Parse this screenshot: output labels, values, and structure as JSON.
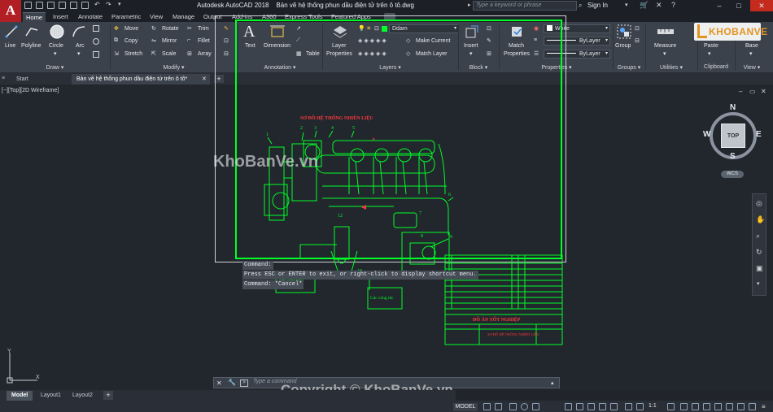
{
  "window": {
    "app_name": "Autodesk AutoCAD 2018",
    "file_name": "Bản vẽ hệ thống phun dầu điện tử trên ô tô.dwg"
  },
  "search": {
    "placeholder": "Type a keyword or phrase"
  },
  "user": {
    "signin": "Sign In"
  },
  "ribbon_tabs": [
    "Home",
    "Insert",
    "Annotate",
    "Parametric",
    "View",
    "Manage",
    "Output",
    "Add-ins",
    "A360",
    "Express Tools",
    "Featured Apps"
  ],
  "ribbon": {
    "draw": {
      "line": "Line",
      "polyline": "Polyline",
      "circle": "Circle",
      "arc": "Arc",
      "title": "Draw"
    },
    "modify": {
      "move": "Move",
      "rotate": "Rotate",
      "trim": "Trim",
      "copy": "Copy",
      "mirror": "Mirror",
      "fillet": "Fillet",
      "stretch": "Stretch",
      "scale": "Scale",
      "array": "Array",
      "title": "Modify"
    },
    "annotation": {
      "text": "Text",
      "dimension": "Dimension",
      "table": "Table",
      "title": "Annotation"
    },
    "layers": {
      "layer_properties_1": "Layer",
      "layer_properties_2": "Properties",
      "current_layer": "Ddam",
      "make_current": "Make Current",
      "match_layer": "Match Layer",
      "title": "Layers"
    },
    "block": {
      "insert": "Insert",
      "title": "Block"
    },
    "properties": {
      "match_1": "Match",
      "match_2": "Properties",
      "color": "White",
      "linetype": "ByLayer",
      "lineweight": "ByLayer",
      "title": "Properties"
    },
    "groups": {
      "group": "Group",
      "title": "Groups"
    },
    "utilities": {
      "measure": "Measure",
      "title": "Utilities"
    },
    "clipboard": {
      "paste": "Paste",
      "title": "Clipboard"
    },
    "view": {
      "base": "Base",
      "title": "View"
    }
  },
  "doc_tabs": {
    "start": "Start",
    "active": "Bản vẽ hệ thống phun dầu điện tử trên ô tô*"
  },
  "viewport": {
    "label": "[−][Top][2D Wireframe]"
  },
  "viewcube": {
    "north": "N",
    "south": "S",
    "east": "E",
    "west": "W",
    "face": "TOP",
    "wcs": "WCS"
  },
  "drawing": {
    "title": "SƠ ĐỒ HỆ THỐNG NHIÊN LIỆU",
    "box_left": "Các cảm biến",
    "box_right": "Các công tắc",
    "stamp_title": "ĐỒ ÁN TỐT NGHIỆP",
    "stamp_subtitle": "SƠ ĐỒ HỆ THỐNG NHIÊN LIỆU"
  },
  "command": {
    "lines": [
      "Command:",
      "Press ESC or ENTER to exit, or right-click to display shortcut menu.",
      "Command: *Cancel*"
    ],
    "placeholder": "Type a command"
  },
  "layout_tabs": [
    "Model",
    "Layout1",
    "Layout2"
  ],
  "status": {
    "model": "MODEL",
    "scale": "1:1"
  },
  "watermarks": {
    "logo": "KHOBANVE",
    "canvas": "KhoBanVe.vn",
    "copyright": "Copyright © KhoBanVe.vn"
  },
  "colors": {
    "drawing_green": "#00ff26",
    "autocad_red": "#b11f24",
    "accent_blue": "#1e6ec8",
    "watermark_orange": "#f29a1c"
  }
}
